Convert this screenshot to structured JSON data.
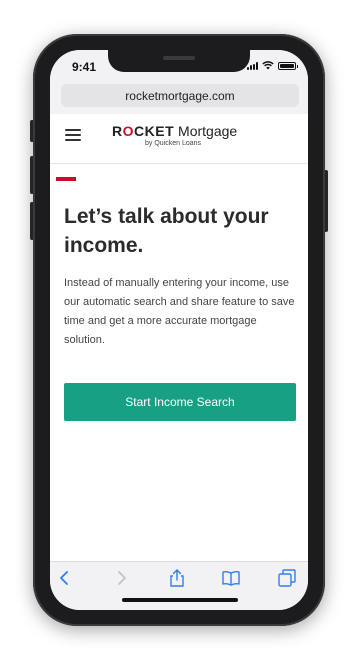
{
  "status_bar": {
    "time": "9:41",
    "icons": [
      "cellular-signal-icon",
      "wifi-icon",
      "battery-icon"
    ]
  },
  "browser": {
    "url": "rocketmortgage.com",
    "toolbar_icons": [
      "back-icon",
      "forward-icon",
      "share-icon",
      "bookmarks-icon",
      "tabs-icon"
    ]
  },
  "header": {
    "logo_brand": "R",
    "logo_brand_o": "O",
    "logo_brand_rest": "CKET",
    "logo_product": "Mortgage",
    "logo_sub": "by Quicken Loans",
    "menu_icon": "hamburger-menu-icon"
  },
  "main": {
    "headline": "Let’s talk about your income.",
    "body": "Instead of manually entering your income, use our automatic search and share feature to save time and get a more accurate mortgage solution.",
    "cta_label": "Start Income Search"
  },
  "colors": {
    "brand_red": "#c8102e",
    "cta_green": "#17a083",
    "ios_blue": "#2f7cf6"
  }
}
